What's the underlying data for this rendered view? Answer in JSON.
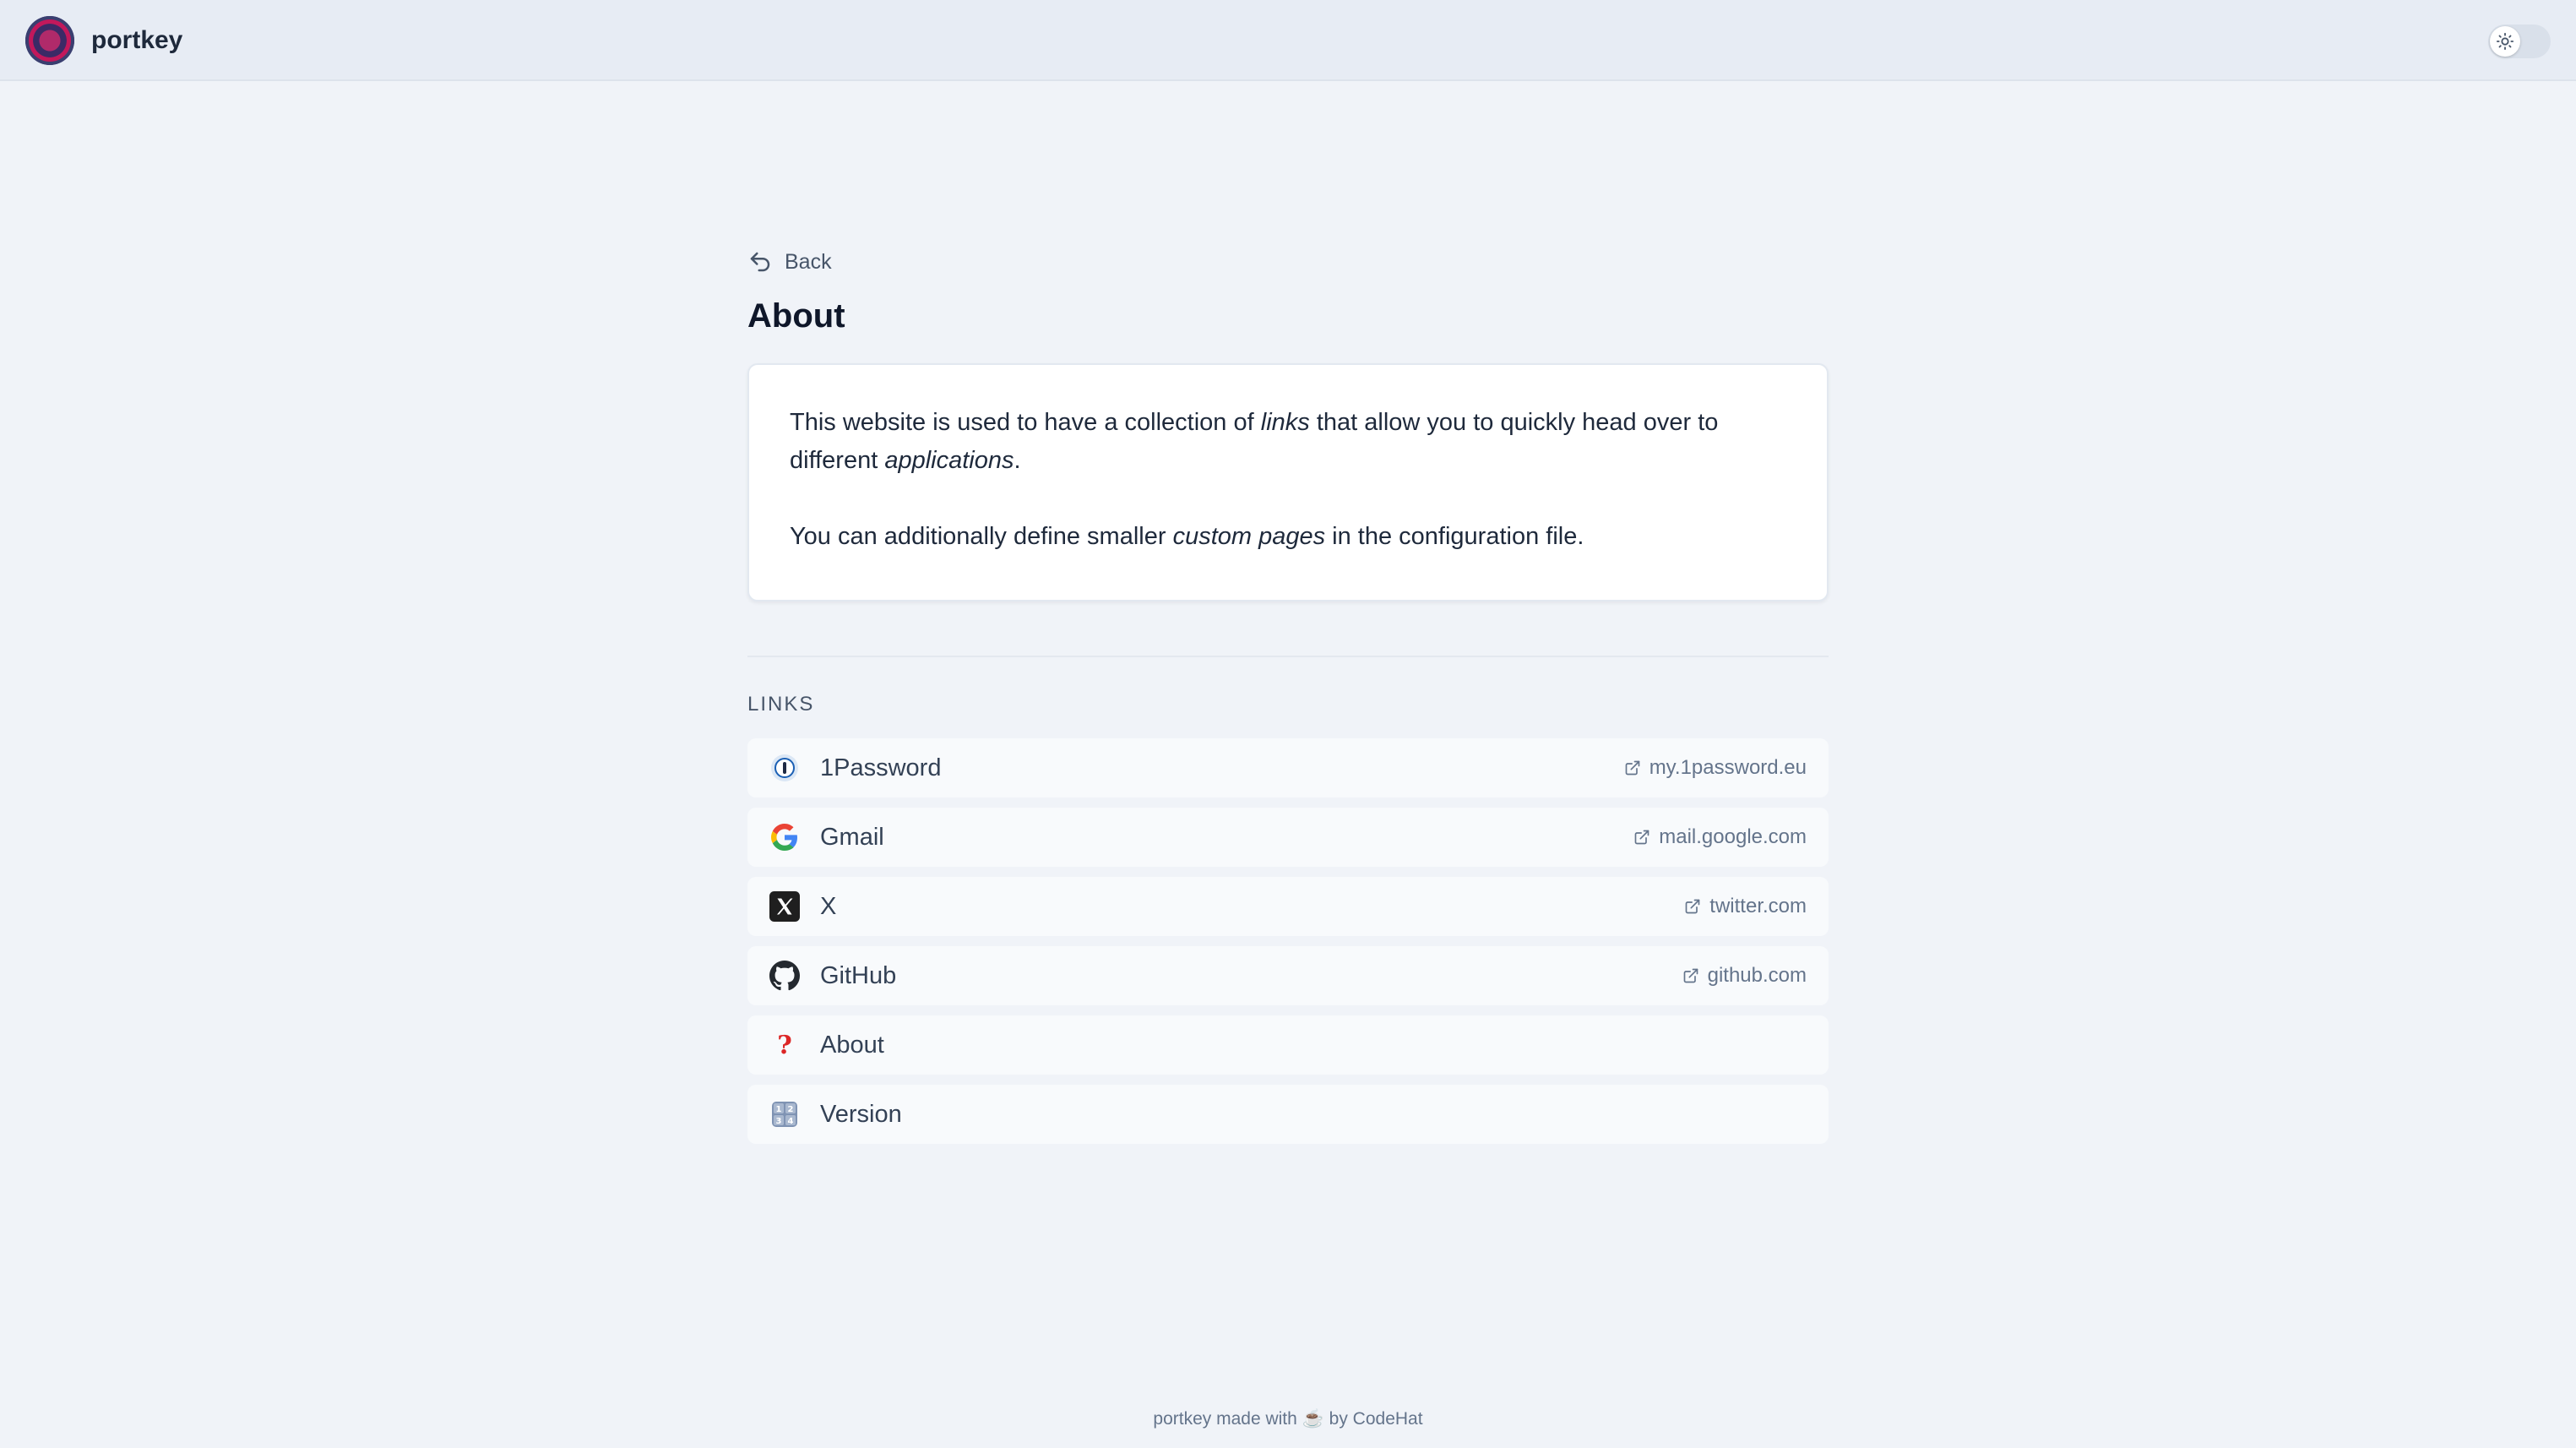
{
  "app": {
    "name": "portkey"
  },
  "nav": {
    "back_label": "Back"
  },
  "page": {
    "title": "About",
    "paragraph1": {
      "t1": "This website is used to have a collection of ",
      "em1": "links",
      "t2": " that allow you to quickly head over to different ",
      "em2": "applications",
      "t3": "."
    },
    "paragraph2": {
      "t1": "You can additionally define smaller ",
      "em1": "custom pages",
      "t2": " in the configuration file."
    }
  },
  "links_section": {
    "label": "LINKS",
    "items": [
      {
        "label": "1Password",
        "host": "my.1password.eu",
        "icon": "onepassword-icon"
      },
      {
        "label": "Gmail",
        "host": "mail.google.com",
        "icon": "google-icon"
      },
      {
        "label": "X",
        "host": "twitter.com",
        "icon": "x-icon"
      },
      {
        "label": "GitHub",
        "host": "github.com",
        "icon": "github-icon"
      },
      {
        "label": "About",
        "host": "",
        "icon": "question-mark-icon"
      },
      {
        "label": "Version",
        "host": "",
        "icon": "numbers-icon"
      }
    ]
  },
  "footer": {
    "made_with": "portkey made with",
    "emoji": "☕",
    "by": "by CodeHat"
  },
  "theme": {
    "toggle_icon": "sun-icon",
    "accent": "#1e293b",
    "background": "#f0f3f8"
  }
}
